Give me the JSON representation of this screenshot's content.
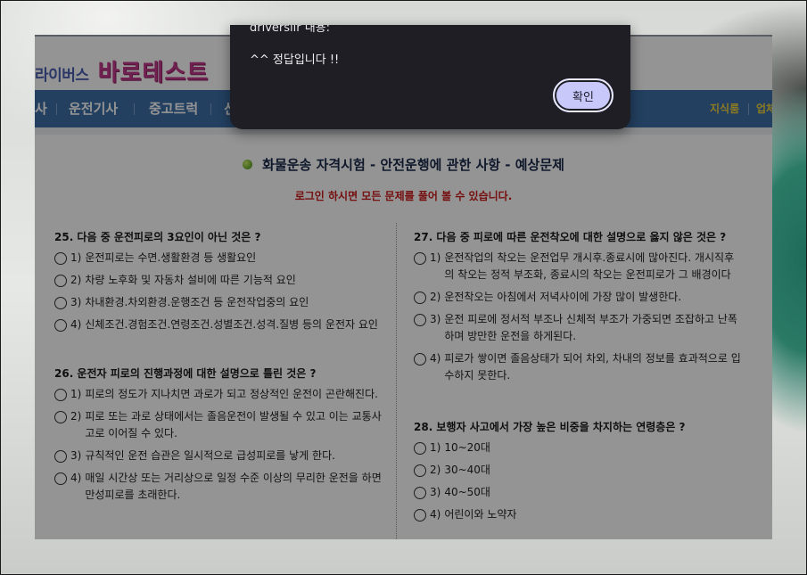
{
  "site": {
    "logo_small": "라이버스",
    "logo_big": "바로테스트"
  },
  "nav": {
    "items": [
      "사",
      "운전기사",
      "중고트럭",
      "신"
    ],
    "right_items": [
      "지식룸",
      "업체"
    ]
  },
  "exam": {
    "title": "화물운송 자격시험 - 안전운행에 관한 사항 - 예상문제",
    "login_note": "로그인 하시면 모든 문제를 풀어 볼 수 있습니다."
  },
  "questions": {
    "q25": {
      "title": "25. 다음 중 운전피로의 3요인이 아닌 것은 ?",
      "options": [
        {
          "num": "1)",
          "text": "운전피로는 수면.생활환경 등 생활요인"
        },
        {
          "num": "2)",
          "text": "차량 노후화 및 자동차 설비에 따른 기능적 요인"
        },
        {
          "num": "3)",
          "text": "차내환경.차외환경.운행조건 등 운전작업중의 요인"
        },
        {
          "num": "4)",
          "text": "신체조건.경험조건.연령조건.성별조건.성격.질병 등의 운전자 요인"
        }
      ]
    },
    "q26": {
      "title": "26. 운전자 피로의 진행과정에 대한 설명으로 틀린 것은 ?",
      "options": [
        {
          "num": "1)",
          "text": "피로의 정도가 지나치면 과로가 되고 정상적인 운전이 곤란해진다."
        },
        {
          "num": "2)",
          "text": "피로 또는 과로 상태에서는 졸음운전이 발생될 수 있고 이는 교통사고로 이어질 수 있다."
        },
        {
          "num": "3)",
          "text": "규칙적인 운전 습관은 일시적으로 급성피로를 낳게 한다."
        },
        {
          "num": "4)",
          "text": "매일 시간상 또는 거리상으로 일정 수준 이상의 무리한 운전을 하면 만성피로를 초래한다."
        }
      ]
    },
    "q27": {
      "title": "27. 다음 중 피로에 따른 운전착오에 대한 설명으로 옳지 않은 것은 ?",
      "options": [
        {
          "num": "1)",
          "text": "운전작업의 착오는 운전업무 개시후.종료시에 많아진다. 개시직후의 착오는 정적 부조화, 종료시의 착오는 운전피로가 그 배경이다"
        },
        {
          "num": "2)",
          "text": "운전착오는 아침에서 저녁사이에 가장 많이 발생한다."
        },
        {
          "num": "3)",
          "text": "운전 피로에 정서적 부조나 신체적 부조가 가중되면 조잡하고 난폭하며 방만한 운전을 하게된다."
        },
        {
          "num": "4)",
          "text": "피로가 쌓이면 졸음상태가 되어 차외, 차내의 정보를 효과적으로 입수하지 못한다."
        }
      ]
    },
    "q28": {
      "title": "28. 보행자 사고에서 가장 높은 비중을 차지하는 연령층은 ?",
      "options": [
        {
          "num": "1)",
          "text": "10~20대"
        },
        {
          "num": "2)",
          "text": "30~40대"
        },
        {
          "num": "3)",
          "text": "40~50대"
        },
        {
          "num": "4)",
          "text": "어린이와 노약자"
        }
      ]
    }
  },
  "dialog": {
    "origin": "driverslir 내용:",
    "message": "^^ 정답입니다 !!",
    "confirm_label": "확인"
  }
}
